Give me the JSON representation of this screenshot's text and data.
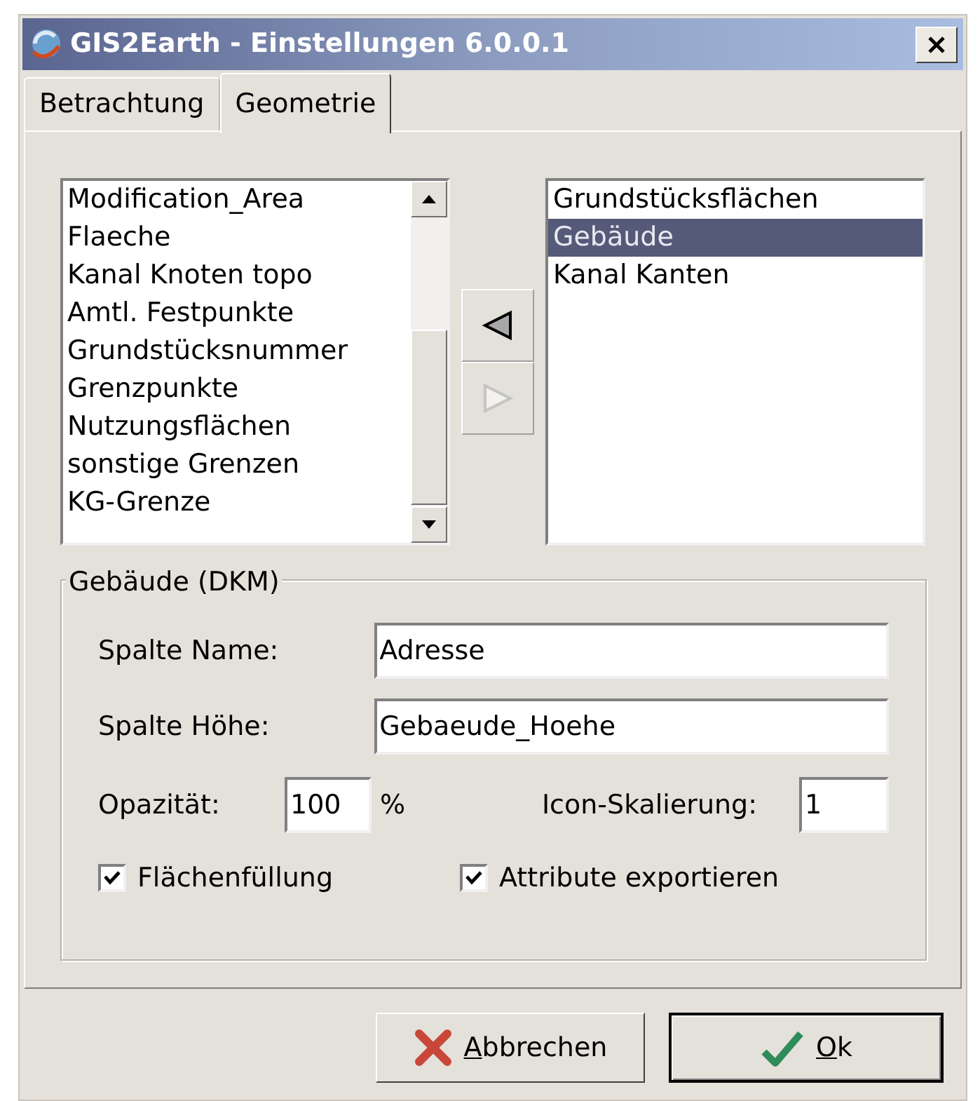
{
  "window": {
    "title": "GIS2Earth - Einstellungen 6.0.0.1"
  },
  "tabs": [
    {
      "label": "Betrachtung",
      "selected": false
    },
    {
      "label": "Geometrie",
      "selected": true
    }
  ],
  "available_layers": [
    {
      "label": "Modification_Area",
      "selected": false
    },
    {
      "label": "Flaeche",
      "selected": false
    },
    {
      "label": "Kanal Knoten topo",
      "selected": false
    },
    {
      "label": "Amtl. Festpunkte",
      "selected": false
    },
    {
      "label": "Grundstücksnummer",
      "selected": false
    },
    {
      "label": "Grenzpunkte",
      "selected": false
    },
    {
      "label": "Nutzungsflächen",
      "selected": false
    },
    {
      "label": "sonstige Grenzen",
      "selected": false
    },
    {
      "label": "KG-Grenze",
      "selected": false
    }
  ],
  "move_buttons": [
    {
      "kind": "left",
      "disabled": false
    },
    {
      "kind": "right",
      "disabled": true
    }
  ],
  "selected_layers": [
    {
      "label": "Grundstücksflächen",
      "selected": false
    },
    {
      "label": "Gebäude",
      "selected": true
    },
    {
      "label": "Kanal Kanten",
      "selected": false
    }
  ],
  "group": {
    "title": "Gebäude (DKM)",
    "fields": [
      {
        "label": "Spalte Name:",
        "value": "Adresse"
      },
      {
        "label": "Spalte Höhe:",
        "value": "Gebaeude_Hoehe"
      }
    ],
    "opacity": {
      "label": "Opazität:",
      "value": "100",
      "unit": "%"
    },
    "icon_scale": {
      "label": "Icon-Skalierung:",
      "value": "1"
    },
    "checkboxes": [
      {
        "label": "Flächenfüllung",
        "checked": true
      },
      {
        "label": "Attribute exportieren",
        "checked": true
      }
    ]
  },
  "buttons": [
    {
      "kind": "cancel",
      "label": "Abbrechen",
      "default": false
    },
    {
      "kind": "ok",
      "label": "Ok",
      "default": true
    }
  ]
}
